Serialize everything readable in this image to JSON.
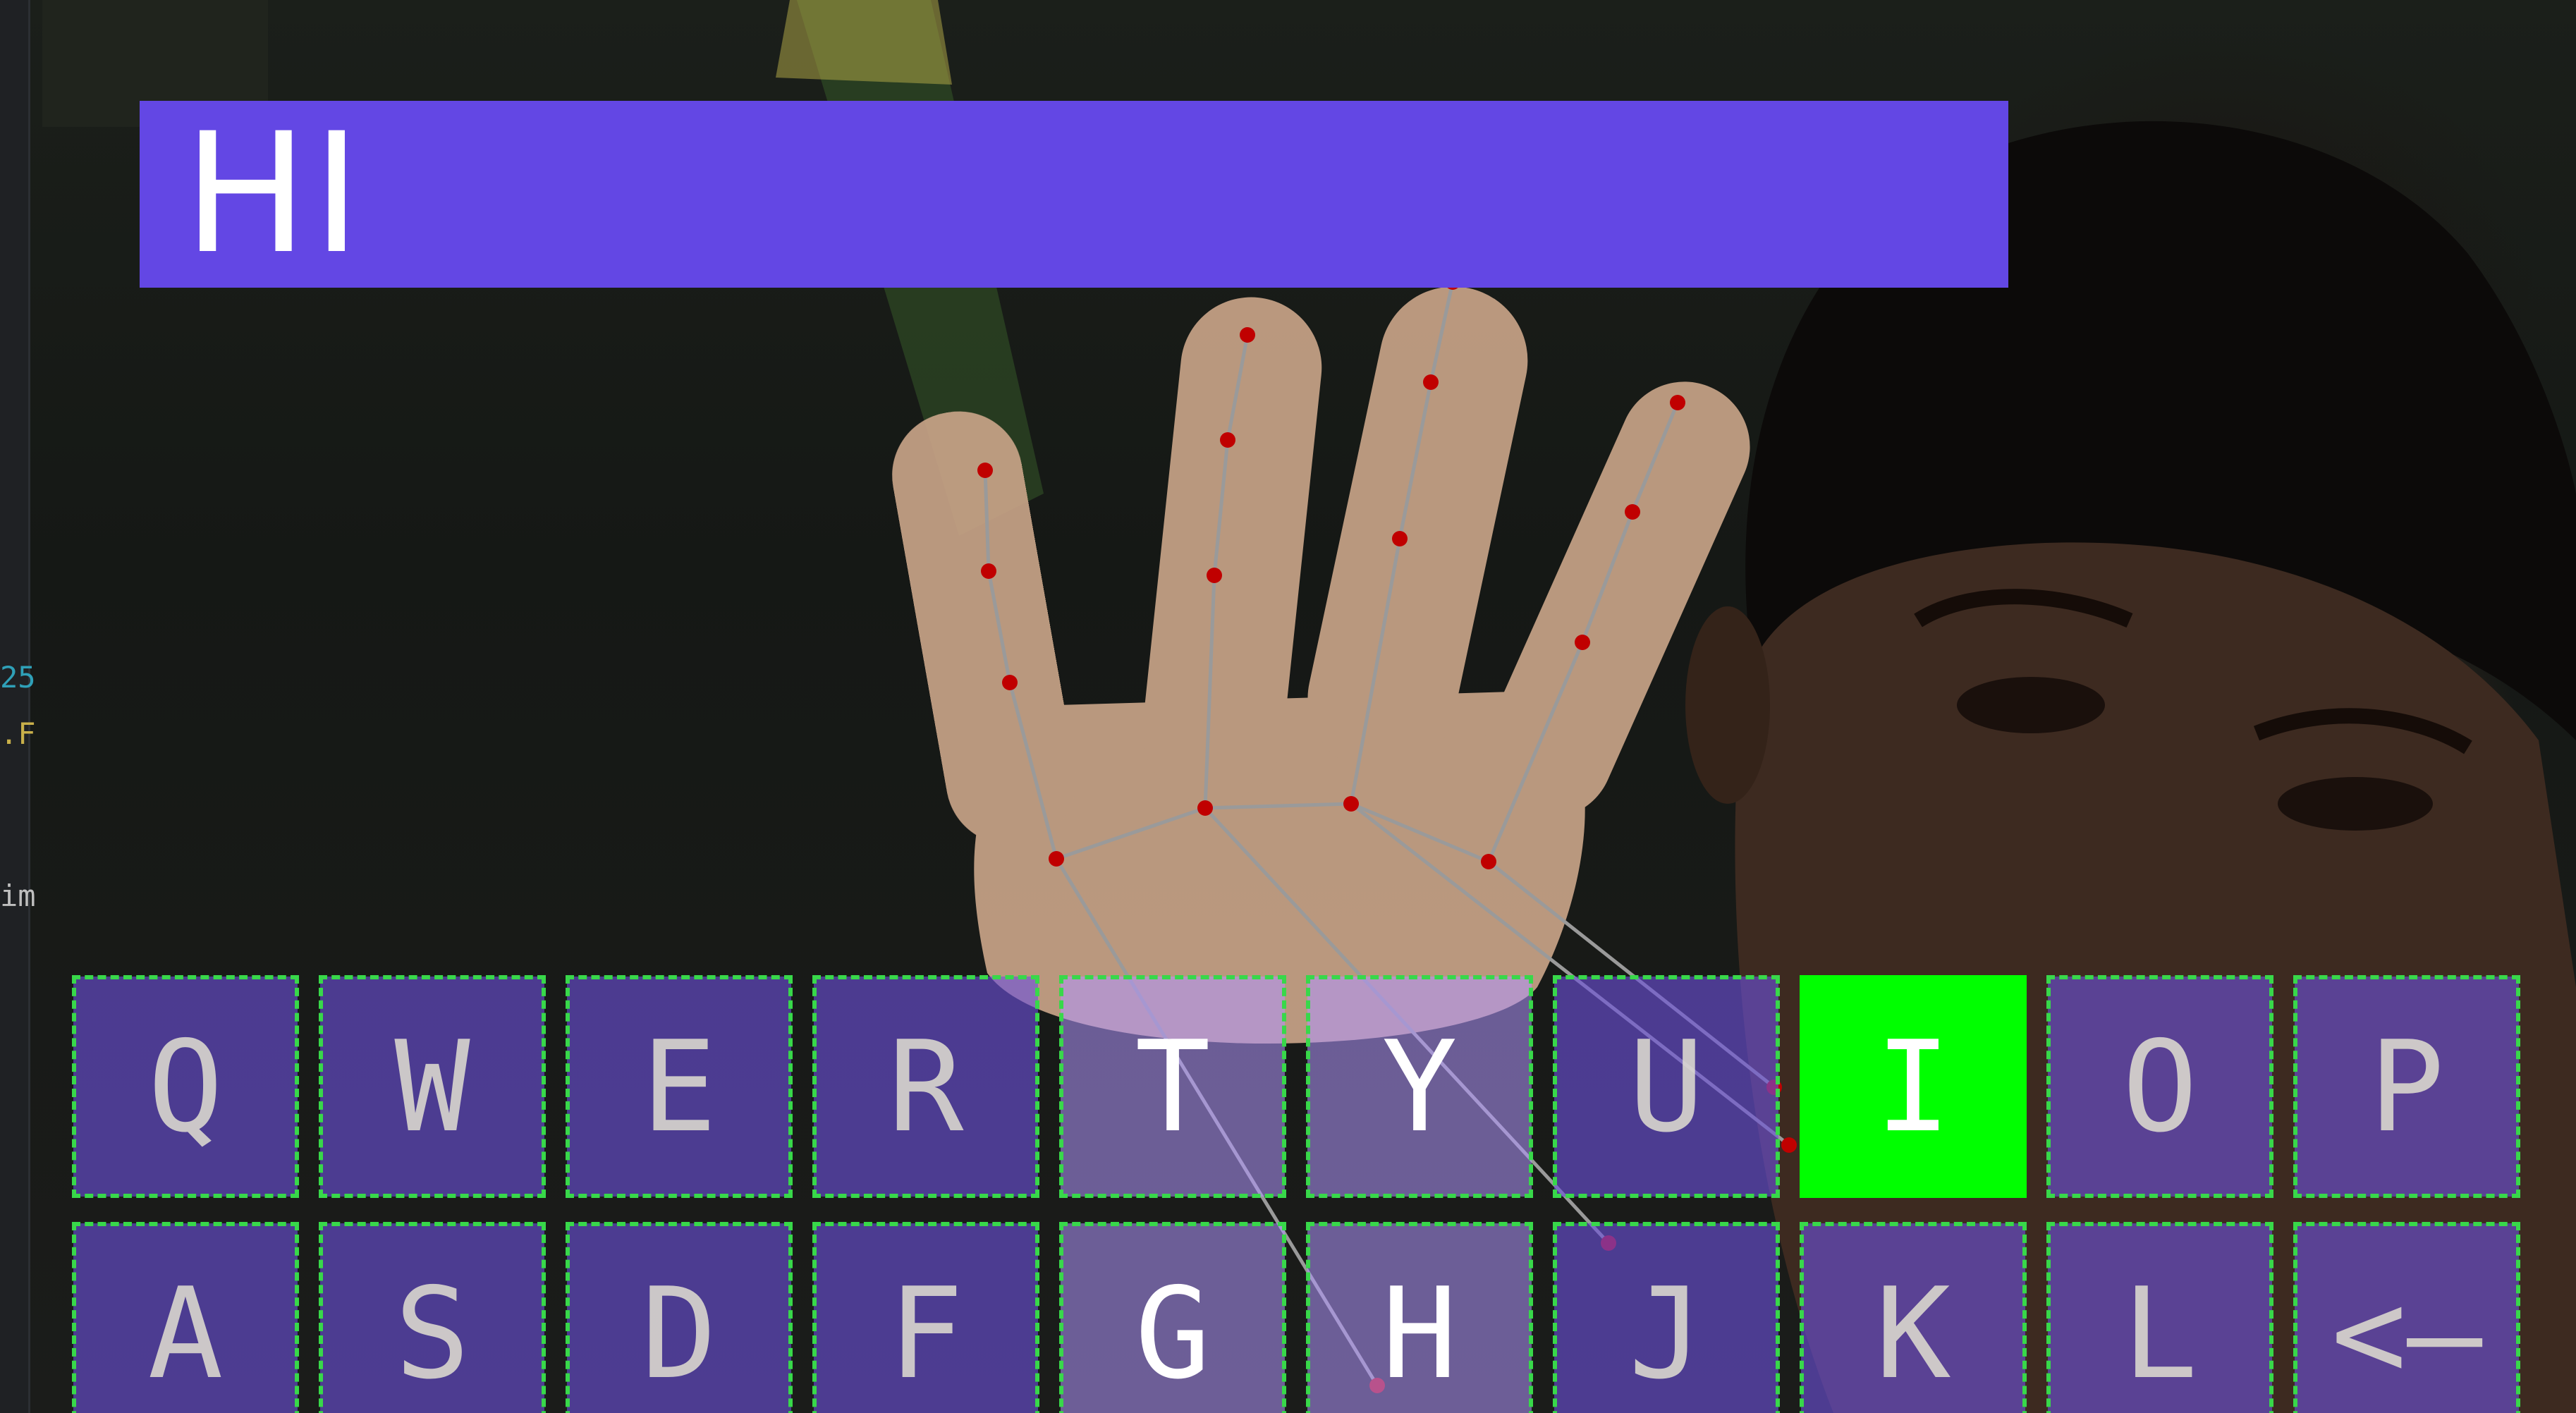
{
  "typed_text": "HI",
  "side_strip": {
    "line1": "25",
    "line2": ".F",
    "line3": "im"
  },
  "keyboard": {
    "row1": [
      {
        "label": "Q",
        "state": "normal"
      },
      {
        "label": "W",
        "state": "normal"
      },
      {
        "label": "E",
        "state": "normal"
      },
      {
        "label": "R",
        "state": "normal"
      },
      {
        "label": "T",
        "state": "highlight"
      },
      {
        "label": "Y",
        "state": "highlight"
      },
      {
        "label": "U",
        "state": "normal"
      },
      {
        "label": "I",
        "state": "pressed"
      },
      {
        "label": "O",
        "state": "normal"
      },
      {
        "label": "P",
        "state": "normal"
      }
    ],
    "row2": [
      {
        "label": "A",
        "state": "normal"
      },
      {
        "label": "S",
        "state": "normal"
      },
      {
        "label": "D",
        "state": "normal"
      },
      {
        "label": "F",
        "state": "normal"
      },
      {
        "label": "G",
        "state": "highlight"
      },
      {
        "label": "H",
        "state": "highlight"
      },
      {
        "label": "J",
        "state": "normal"
      },
      {
        "label": "K",
        "state": "normal"
      },
      {
        "label": "L",
        "state": "normal"
      },
      {
        "label": "<—",
        "state": "normal"
      }
    ]
  },
  "colors": {
    "banner": "#6347e4",
    "key_fill": "#6c50dc",
    "key_border": "#38d84a",
    "key_pressed": "#00ff00",
    "landmark_point": "#c00000",
    "landmark_line": "#9a9a9a"
  },
  "hand_tracking": {
    "landmark_count": 21
  }
}
